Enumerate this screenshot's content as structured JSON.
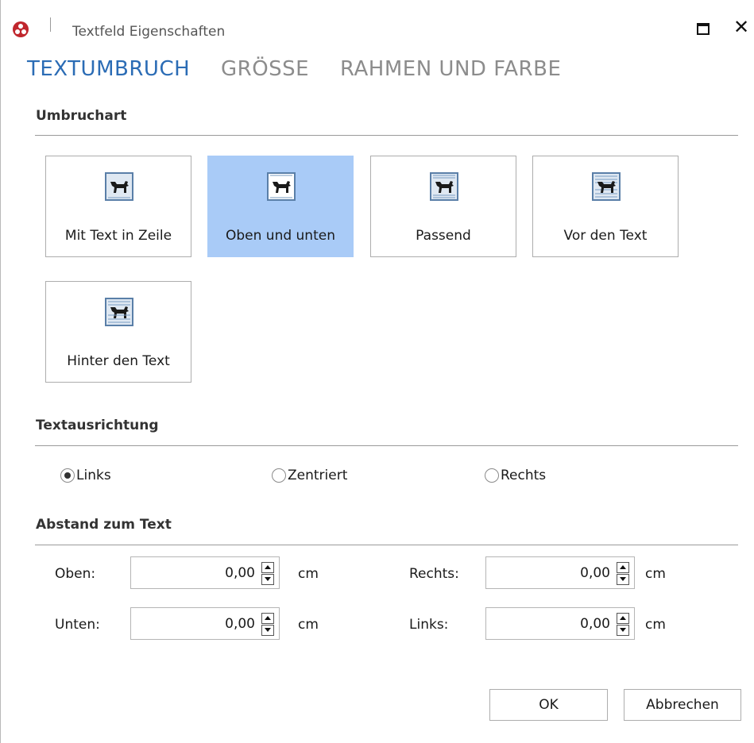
{
  "window": {
    "title": "Textfeld Eigenschaften"
  },
  "tabs": [
    {
      "label": "TEXTUMBRUCH",
      "active": true
    },
    {
      "label": "GRÖSSE",
      "active": false
    },
    {
      "label": "RAHMEN UND FARBE",
      "active": false
    }
  ],
  "umbruchart": {
    "title": "Umbruchart",
    "options": [
      {
        "label": "Mit Text in Zeile",
        "icon": "wrap-inline-icon",
        "selected": false
      },
      {
        "label": "Oben und unten",
        "icon": "wrap-top-bottom-icon",
        "selected": true
      },
      {
        "label": "Passend",
        "icon": "wrap-square-icon",
        "selected": false
      },
      {
        "label": "Vor den Text",
        "icon": "wrap-in-front-icon",
        "selected": false
      },
      {
        "label": "Hinter den Text",
        "icon": "wrap-behind-icon",
        "selected": false
      }
    ]
  },
  "textausrichtung": {
    "title": "Textausrichtung",
    "options": [
      {
        "label": "Links",
        "checked": true
      },
      {
        "label": "Zentriert",
        "checked": false
      },
      {
        "label": "Rechts",
        "checked": false
      }
    ]
  },
  "abstand": {
    "title": "Abstand zum Text",
    "fields": [
      {
        "label": "Oben:",
        "value": "0,00",
        "unit": "cm"
      },
      {
        "label": "Unten:",
        "value": "0,00",
        "unit": "cm"
      },
      {
        "label": "Rechts:",
        "value": "0,00",
        "unit": "cm"
      },
      {
        "label": "Links:",
        "value": "0,00",
        "unit": "cm"
      }
    ]
  },
  "buttons": {
    "ok": "OK",
    "cancel": "Abbrechen"
  },
  "colors": {
    "accent": "#2b6cb5",
    "selected_tile": "#a9cbf7",
    "app_icon": "#c0262d"
  }
}
